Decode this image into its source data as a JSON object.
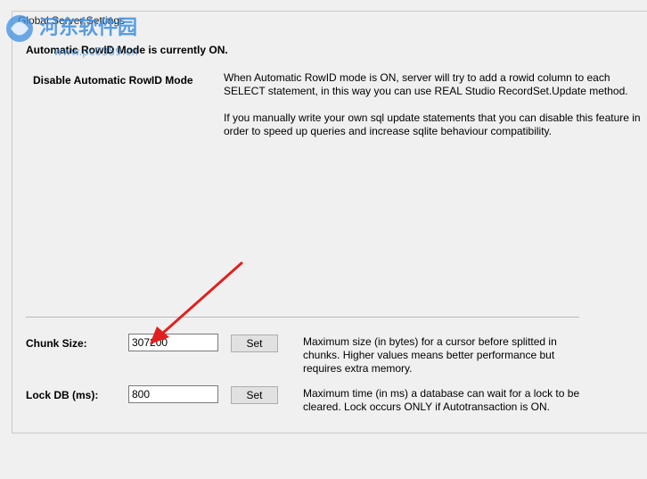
{
  "group": {
    "title": "Global Server Settings",
    "rowid_status": "Automatic RowID Mode is currently ON."
  },
  "rowid": {
    "button_label": "Disable Automatic RowID Mode",
    "description_1": "When Automatic RowID mode is ON, server will try to add a rowid column to each SELECT statement, in this way you can use REAL Studio RecordSet.Update method.",
    "description_2": "If you manually write your own sql update statements that you can disable this feature in order to speed up queries and increase sqlite behaviour compatibility."
  },
  "chunk": {
    "label": "Chunk Size:",
    "value": "307200",
    "set_label": "Set",
    "description": "Maximum size (in bytes) for a cursor before splitted in chunks. Higher values means better performance but requires extra memory."
  },
  "lockdb": {
    "label": "Lock DB (ms):",
    "value": "800",
    "set_label": "Set",
    "description": "Maximum time (in ms) a database can wait for a lock to be cleared. Lock occurs ONLY if Autotransaction is ON."
  },
  "watermark": {
    "logo_icon": "site-logo-icon",
    "brand": "河东软件园",
    "url": "www.pc0359.cn"
  },
  "annotation": {
    "arrow_color": "#e02020"
  }
}
